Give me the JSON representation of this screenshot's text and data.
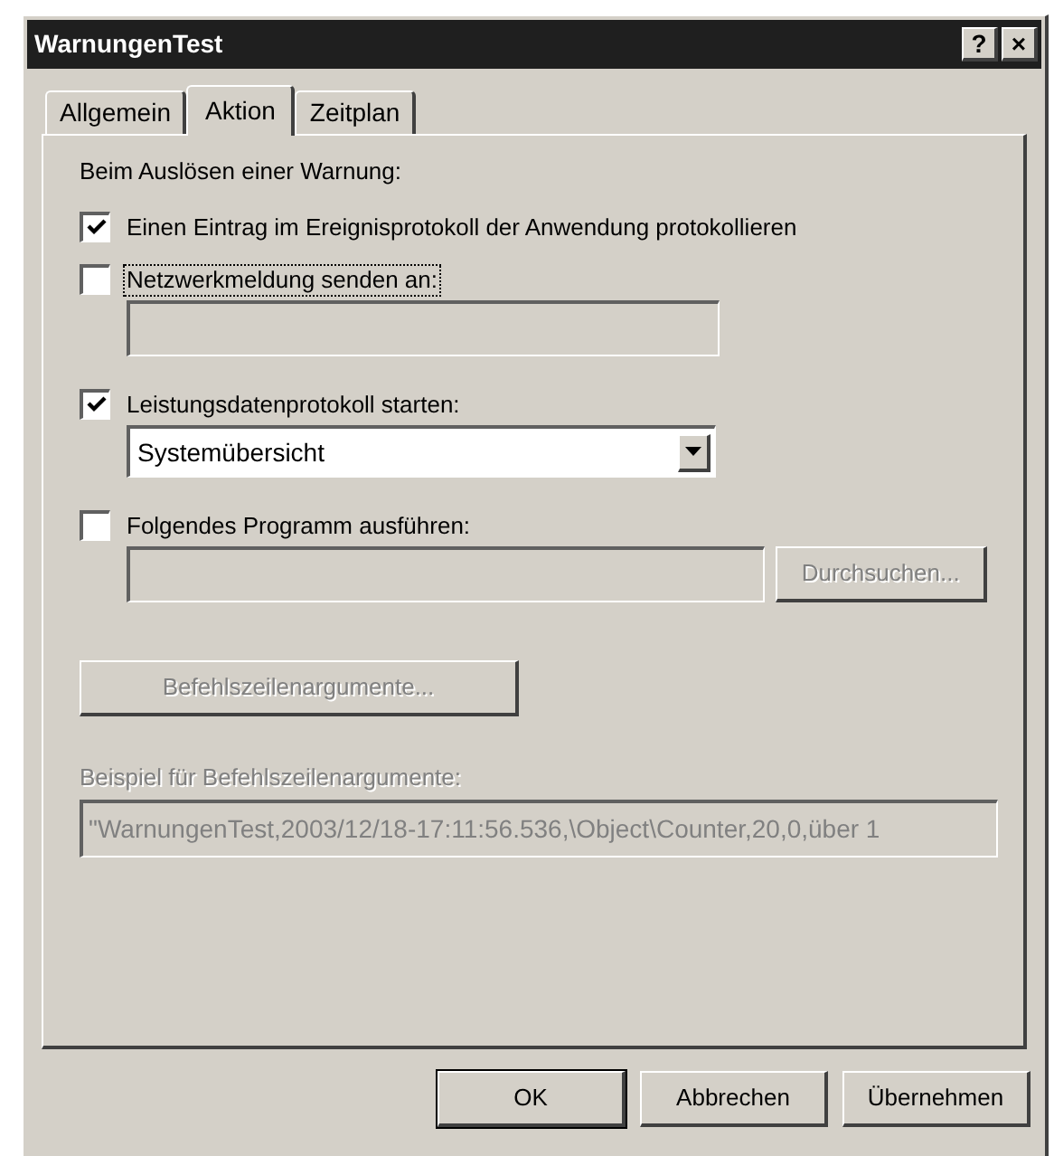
{
  "window": {
    "title": "WarnungenTest",
    "title_buttons": [
      "?",
      "×"
    ]
  },
  "tabs": [
    {
      "label": "Allgemein",
      "selected": false
    },
    {
      "label": "Aktion",
      "selected": true
    },
    {
      "label": "Zeitplan",
      "selected": false
    }
  ],
  "heading": "Beim Auslösen einer Warnung:",
  "options": [
    {
      "kind": "plain",
      "label": "Einen Eintrag im Ereignisprotokoll der Anwendung protokollieren",
      "checked": true,
      "focused": false
    },
    {
      "kind": "field",
      "label": "Netzwerkmeldung senden an:",
      "checked": false,
      "focused": true,
      "field": {
        "disabled": true
      }
    },
    {
      "kind": "dropdown",
      "label": "Leistungsdatenprotokoll starten:",
      "checked": true,
      "focused": false,
      "dropdown": {
        "value": "Systemübersicht"
      }
    },
    {
      "kind": "field_button",
      "label": "Folgendes Programm ausführen:",
      "checked": false,
      "focused": false,
      "field": {
        "disabled": true
      },
      "button": {
        "label": "Durchsuchen...",
        "disabled": true
      }
    }
  ],
  "args_button": {
    "label": "Befehlszeilenargumente...",
    "disabled": true
  },
  "example": {
    "label": "Beispiel für Befehlszeilenargumente:",
    "value": "\"WarnungenTest,2003/12/18-17:11:56.536,\\Object\\Counter,20,0,über 1",
    "disabled": true
  },
  "buttons": [
    {
      "label": "OK",
      "default": true
    },
    {
      "label": "Abbrechen",
      "default": false
    },
    {
      "label": "Übernehmen",
      "default": false
    }
  ]
}
